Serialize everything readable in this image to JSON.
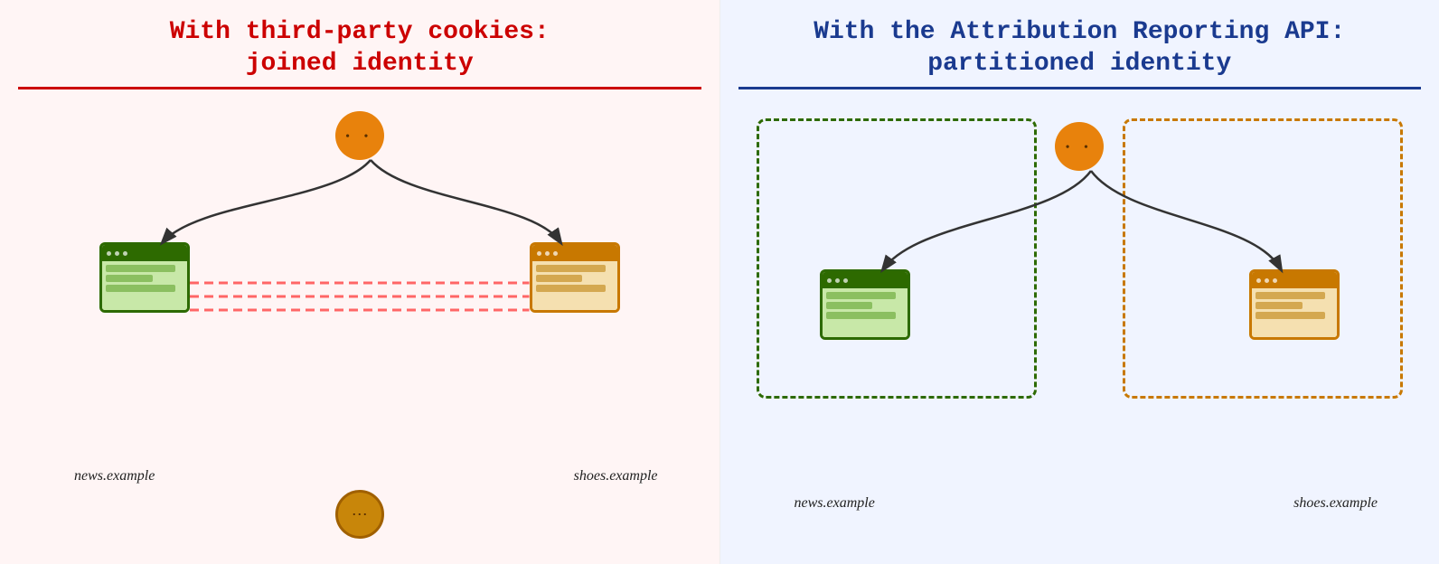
{
  "left_panel": {
    "title_line1": "With third-party cookies:",
    "title_line2": "joined identity",
    "label_left": "news.example",
    "label_right": "shoes.example"
  },
  "right_panel": {
    "title_line1": "With the Attribution Reporting API:",
    "title_line2": "partitioned identity",
    "label_left": "news.example",
    "label_right": "shoes.example"
  }
}
